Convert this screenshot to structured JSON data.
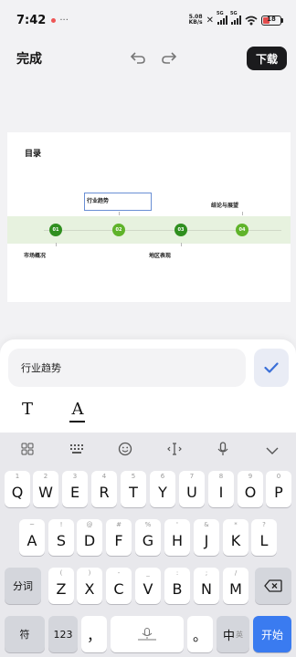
{
  "status_bar": {
    "time": "7:42",
    "net_speed_value": "5.08",
    "net_speed_unit": "KB/s",
    "signal_1_label": "5G",
    "signal_2_label": "5G",
    "battery": "18"
  },
  "toolbar": {
    "done_label": "完成",
    "undo_icon": "undo-icon",
    "redo_icon": "redo-icon",
    "download_label": "下载"
  },
  "slide": {
    "title": "目录",
    "nodes": [
      "01",
      "02",
      "03",
      "04"
    ],
    "labels": {
      "item_1": "市场概况",
      "item_2": "行业趋势",
      "item_3": "地区表现",
      "item_4": "结论与展望"
    },
    "colors": {
      "band": "#e7f2df",
      "node_dark": "#2f8f1f",
      "node_light": "#5fb32a"
    }
  },
  "editor": {
    "input_value": "行业趋势",
    "text_style_label": "T",
    "text_color_label": "A"
  },
  "keyboard": {
    "toolbar_icons": [
      "grid-icon",
      "keyboard-layout-icon",
      "emoji-icon",
      "cursor-icon",
      "mic-icon",
      "collapse-icon"
    ],
    "row1": [
      {
        "key": "Q",
        "hint": "1"
      },
      {
        "key": "W",
        "hint": "2"
      },
      {
        "key": "E",
        "hint": "3"
      },
      {
        "key": "R",
        "hint": "4"
      },
      {
        "key": "T",
        "hint": "5"
      },
      {
        "key": "Y",
        "hint": "6"
      },
      {
        "key": "U",
        "hint": "7"
      },
      {
        "key": "I",
        "hint": "8"
      },
      {
        "key": "O",
        "hint": "9"
      },
      {
        "key": "P",
        "hint": "0"
      }
    ],
    "row2": [
      {
        "key": "A",
        "hint": "~"
      },
      {
        "key": "S",
        "hint": "!"
      },
      {
        "key": "D",
        "hint": "@"
      },
      {
        "key": "F",
        "hint": "#"
      },
      {
        "key": "G",
        "hint": "%"
      },
      {
        "key": "H",
        "hint": "'"
      },
      {
        "key": "J",
        "hint": "&"
      },
      {
        "key": "K",
        "hint": "*"
      },
      {
        "key": "L",
        "hint": "?"
      }
    ],
    "row3": [
      {
        "key": "Z",
        "hint": "("
      },
      {
        "key": "X",
        "hint": ")"
      },
      {
        "key": "C",
        "hint": "-"
      },
      {
        "key": "V",
        "hint": "_"
      },
      {
        "key": "B",
        "hint": ":"
      },
      {
        "key": "N",
        "hint": ";"
      },
      {
        "key": "M",
        "hint": "/"
      }
    ],
    "segment_label": "分词",
    "symbol_label": "符",
    "number_label": "123",
    "comma_label": "，",
    "period_label": "。",
    "lang_label": "中",
    "lang_sub": "英",
    "enter_label": "开始",
    "enter_color": "#3a7bf0"
  }
}
